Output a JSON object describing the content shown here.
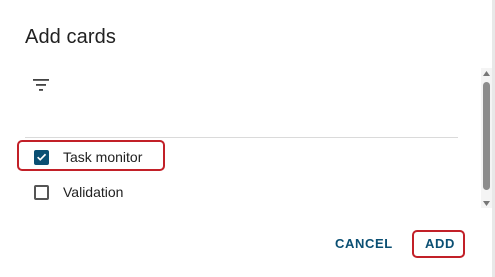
{
  "dialog": {
    "title": "Add cards",
    "filter_icon": "filter-list-icon"
  },
  "cards": [
    {
      "label": "Task monitor",
      "checked": true
    },
    {
      "label": "Validation",
      "checked": false
    }
  ],
  "actions": {
    "cancel_label": "CANCEL",
    "add_label": "ADD"
  },
  "colors": {
    "accent": "#0a4f73",
    "highlight": "#c22028"
  }
}
